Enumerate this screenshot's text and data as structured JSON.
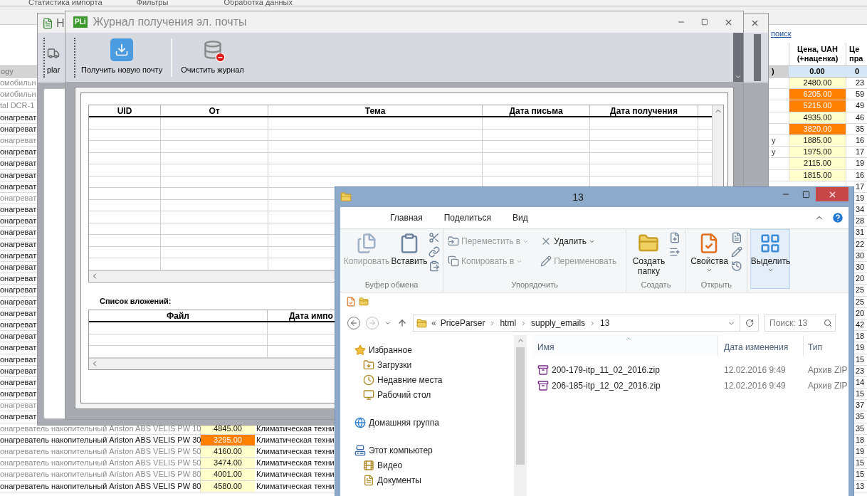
{
  "sheet": {
    "ribbon_groups": [
      "Статистика импорта",
      "Фильтры",
      "Обработка данных"
    ],
    "search_link": "поиск",
    "header": [
      {
        "lines": [
          "Цена, UAH",
          "(+наценка)"
        ]
      },
      {
        "lines": [
          "Це",
          "пра"
        ]
      }
    ],
    "summary": {
      "label": "ogy",
      "mark": ")",
      "price": "0.00",
      "list": "0"
    },
    "rows": [
      {
        "name": "омобильн",
        "inactive": true,
        "markup_price": "2480.00",
        "color": "#ffffcc",
        "list": "23"
      },
      {
        "name": "омобильн",
        "inactive": true,
        "markup_price": "6205.00",
        "color": "#ff8000",
        "list": "59"
      },
      {
        "name": "tal DCR-1",
        "inactive": true,
        "markup_price": "5215.00",
        "color": "#ff8000",
        "list": "49"
      },
      {
        "name": "онагреват",
        "inactive": false,
        "markup_price": "4935.00",
        "color": "#ffffcc",
        "list": "46"
      },
      {
        "name": "онагреват",
        "inactive": false,
        "markup_price": "3820.00",
        "color": "#ff8000",
        "list": "35"
      },
      {
        "name": "онагреват",
        "inactive": true,
        "fragment": "y",
        "markup_price": "1885.00",
        "color": "#ffffcc",
        "list": "16"
      },
      {
        "name": "онагреват",
        "inactive": false,
        "fragment": "y",
        "markup_price": "1975.00",
        "color": "#ffffcc",
        "list": "17"
      },
      {
        "name": "онагреват",
        "inactive": false,
        "markup_price": "2115.00",
        "color": "#ffffcc",
        "list": "19"
      },
      {
        "name": "онагреват",
        "inactive": false,
        "markup_price": "1815.00",
        "color": "#ffffcc",
        "list": "16"
      },
      {
        "name": "онагреват",
        "inactive": false,
        "list": "17"
      },
      {
        "name": "онагреват",
        "inactive": true,
        "list": "19"
      },
      {
        "name": "онагреват",
        "inactive": false,
        "list": "34"
      },
      {
        "name": "онагреват",
        "inactive": false,
        "list": "28"
      },
      {
        "name": "онагреват",
        "inactive": false,
        "list": "31"
      },
      {
        "name": "онагреват",
        "inactive": false,
        "list": "22"
      },
      {
        "name": "онагреват",
        "inactive": false,
        "list": "30"
      },
      {
        "name": "онагреват",
        "inactive": false,
        "list": "30"
      },
      {
        "name": "онагреват",
        "inactive": false,
        "list": "20"
      },
      {
        "name": "онагреват",
        "inactive": false,
        "list": "25"
      },
      {
        "name": "онагреват",
        "inactive": false,
        "list": "25"
      },
      {
        "name": "онагреват",
        "inactive": false,
        "list": "20"
      },
      {
        "name": "онагреват",
        "inactive": false,
        "list": "42"
      },
      {
        "name": "онагреват",
        "inactive": false,
        "list": "18"
      },
      {
        "name": "онагреват",
        "inactive": false,
        "list": "19"
      },
      {
        "name": "онагреват",
        "inactive": false,
        "list": "15"
      },
      {
        "name": "онагреват",
        "inactive": false,
        "list": "23"
      },
      {
        "name": "онагреват",
        "inactive": false,
        "list": "14"
      },
      {
        "name": "онагреват",
        "inactive": false,
        "list": "15"
      },
      {
        "name": "онагреват",
        "inactive": true,
        "list": "37"
      },
      {
        "name": "онагреват",
        "inactive": false,
        "list": "35"
      },
      {
        "name": "онагреватель накопительный Ariston ABS VELIS PW 10",
        "inactive": true,
        "price": "4845.00",
        "color": "#ffffcc",
        "category": "Климатическая техни",
        "list": "35"
      },
      {
        "name": "онагреватель накопительный Ariston ABS VELIS PW 30",
        "inactive": false,
        "price": "3295.00",
        "color": "#ff8000",
        "category": "Климатическая техни",
        "list": "18"
      },
      {
        "name": "онагреватель накопительный Ariston ABS VELIS PW 50",
        "inactive": true,
        "price": "4160.00",
        "color": "#ffffcc",
        "category": "Климатическая техни",
        "list": "19"
      },
      {
        "name": "онагреватель накопительный Ariston ABS VELIS PW 50",
        "inactive": true,
        "price": "3474.00",
        "color": "#ffffcc",
        "category": "Климатическая техни",
        "list": "15"
      },
      {
        "name": "онагреватель накопительный Ariston ABS VELIS PW 80",
        "inactive": true,
        "price": "4001.00",
        "color": "#ffffcc",
        "category": "Климатическая техни",
        "list": "15"
      },
      {
        "name": "онагреватель накопительный Ariston ABS VELIS PW 80",
        "inactive": false,
        "price": "4580.00",
        "color": "#ffffcc",
        "category": "Климатическая техни",
        "list": "13"
      }
    ]
  },
  "back_window": {
    "title": "Н",
    "toolbar_label": "plar"
  },
  "mail_log": {
    "logo": "PLi",
    "title": "Журнал получения эл. почты",
    "toolbar": [
      {
        "label": "Получить новую почту"
      },
      {
        "label": "Очистить журнал"
      }
    ],
    "columns": [
      "UID",
      "От",
      "Тема",
      "Дата письма",
      "Дата получения"
    ],
    "attachments_label": "Список вложений:",
    "attachment_columns": [
      "Файл",
      "Дата импо"
    ]
  },
  "explorer": {
    "title": "13",
    "tabs": [
      "Главная",
      "Поделиться",
      "Вид"
    ],
    "ribbon": [
      {
        "label": "Буфер обмена",
        "items": [
          {
            "label": "Копировать",
            "disabled": true,
            "dropdown": false,
            "highlighted": false
          },
          {
            "label": "Вставить",
            "disabled": false,
            "dropdown": false,
            "highlighted": false
          }
        ]
      },
      {
        "label": "Упорядочить",
        "items": [
          {
            "label": "Переместить в",
            "disabled": true,
            "dropdown": true
          },
          {
            "label": "Удалить",
            "disabled": false,
            "dropdown": true
          },
          {
            "label": "Копировать в",
            "disabled": true,
            "dropdown": true
          },
          {
            "label": "Переименовать",
            "disabled": true,
            "dropdown": false
          }
        ]
      },
      {
        "label": "Создать",
        "items": [
          {
            "label": "Создать папку",
            "disabled": false,
            "dropdown": false,
            "highlighted": false
          }
        ]
      },
      {
        "label": "Открыть",
        "items": [
          {
            "label": "Свойства",
            "disabled": false,
            "dropdown": true,
            "highlighted": false
          }
        ]
      },
      {
        "items": [
          {
            "label": "Выделить",
            "disabled": false,
            "dropdown": true,
            "highlighted": true
          }
        ]
      }
    ],
    "address": {
      "overflow_mark": "«",
      "crumbs": [
        "PriceParser",
        "html",
        "supply_emails",
        "13"
      ]
    },
    "search": {
      "placeholder": "Поиск: 13"
    },
    "nav": [
      {
        "label": "Избранное",
        "children": [
          {
            "label": "Загрузки"
          },
          {
            "label": "Недавние места"
          },
          {
            "label": "Рабочий стол"
          }
        ]
      },
      {
        "label": "Домашняя группа"
      },
      {
        "label": "Этот компьютер",
        "children": [
          {
            "label": "Видео"
          },
          {
            "label": "Документы"
          }
        ]
      }
    ],
    "columns": [
      {
        "label": "Имя",
        "sorted": true
      },
      {
        "label": "Дата изменения",
        "sorted": false
      },
      {
        "label": "Тип",
        "sorted": false
      }
    ],
    "files": [
      {
        "name": "200-179-itp_11_02_2016.zip",
        "date": "12.02.2016 9:49",
        "type": "Архив ZIP"
      },
      {
        "name": "206-185-itp_12_02_2016.zip",
        "date": "12.02.2016 9:49",
        "type": "Архив ZIP"
      }
    ]
  }
}
